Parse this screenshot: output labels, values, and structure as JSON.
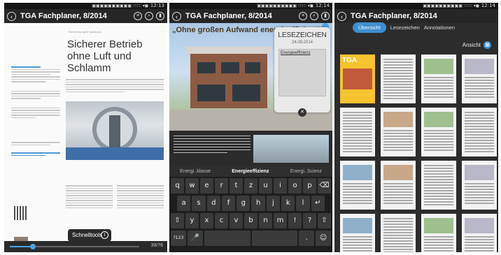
{
  "status": {
    "time": "12:13",
    "time2": "12:14",
    "icons": "▣▣▣▣▣▣▣▣▣▣ ⫶⫶⫶⫶⫶⫶⫶⫶ ▾◼"
  },
  "app": {
    "title": "TGA Fachplaner, 8/2014"
  },
  "phone1": {
    "kicker": "Referenzprojekt Spitzbock",
    "headline": "Sicherer Betrieb ohne Luft und Schlamm",
    "popup": "Schnelltools",
    "page_indicator": "39/76",
    "progress_fraction": 0.18
  },
  "phone2": {
    "quote": "„Ohne großen Aufwand energieeffizient“",
    "bookmark": {
      "title": "LESEZEICHEN",
      "date": "24.09.2014",
      "note": "Energieeffizienz"
    },
    "suggestions": [
      "Energi..klasse",
      "Energieeffizienz",
      "Energi..Scienz"
    ],
    "keyboard": {
      "row1": [
        "q",
        "w",
        "e",
        "r",
        "t",
        "z",
        "u",
        "i",
        "o",
        "p",
        "⌫"
      ],
      "row2": [
        "a",
        "s",
        "d",
        "f",
        "g",
        "h",
        "j",
        "k",
        "l",
        "↵"
      ],
      "row3": [
        "⇧",
        "y",
        "x",
        "c",
        "v",
        "b",
        "n",
        "m",
        "!",
        "?",
        "⇧"
      ],
      "row4": [
        "?123",
        "🎤",
        "",
        "",
        ".",
        "☺"
      ]
    }
  },
  "phone3": {
    "tabs": [
      "Übersicht",
      "Lesezeichen",
      "Annotationen"
    ],
    "view_label": "Ansicht",
    "cover_label": "TGA"
  }
}
